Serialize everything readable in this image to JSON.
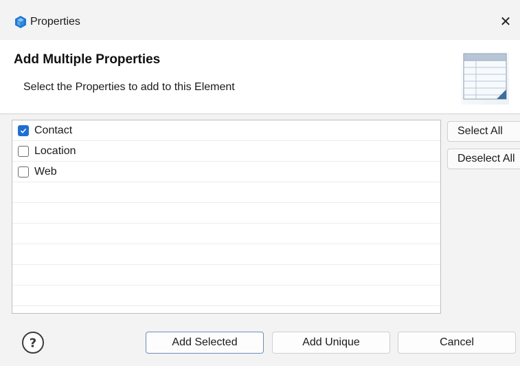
{
  "window": {
    "title": "Properties",
    "app_icon": "cube-icon",
    "close_icon": "close-icon",
    "close_glyph": "✕"
  },
  "header": {
    "title": "Add Multiple Properties",
    "subtitle": "Select the Properties to add to this Element",
    "icon": "table-wizard-icon"
  },
  "list": {
    "items": [
      {
        "label": "Contact",
        "checked": true
      },
      {
        "label": "Location",
        "checked": false
      },
      {
        "label": "Web",
        "checked": false
      }
    ]
  },
  "side_buttons": {
    "select_all": "Select All",
    "deselect_all": "Deselect All"
  },
  "footer": {
    "help_icon": "help-icon",
    "help_glyph": "?",
    "add_selected": "Add Selected",
    "add_unique": "Add Unique",
    "cancel": "Cancel"
  },
  "colors": {
    "accent": "#1f6fd1",
    "window_bg": "#f3f3f3",
    "header_bg": "#ffffff"
  }
}
